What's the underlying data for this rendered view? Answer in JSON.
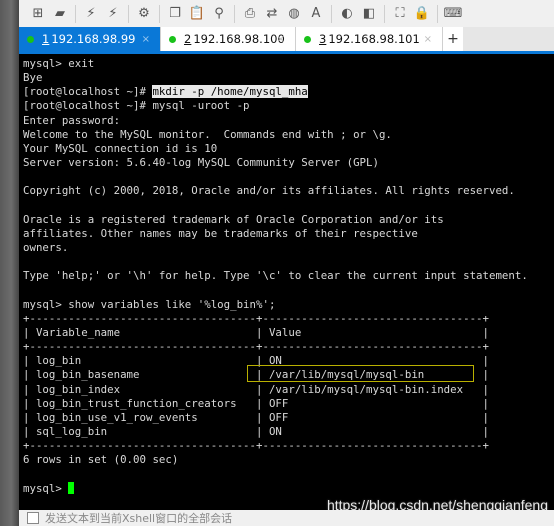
{
  "toolbar": {
    "icons": [
      "new-session-icon",
      "open-folder-icon",
      "connect-icon",
      "disconnect-icon",
      "properties-icon",
      "copy-icon",
      "paste-icon",
      "find-icon",
      "print-icon",
      "transfer-icon",
      "globe-icon",
      "font-icon",
      "xftp-icon",
      "script-icon",
      "fullscreen-icon",
      "lock-icon",
      "keyboard-icon"
    ]
  },
  "tabs": [
    {
      "number": "1",
      "label": " 192.168.98.99",
      "active": true,
      "close": "×"
    },
    {
      "number": "2",
      "label": " 192.168.98.100",
      "active": false,
      "close": "×"
    },
    {
      "number": "3",
      "label": " 192.168.98.101",
      "active": false,
      "close": "×"
    }
  ],
  "add_tab": "+",
  "terminal": {
    "lines": [
      "mysql> exit",
      "Bye",
      {
        "prefix": "[root@localhost ~]# ",
        "highlight": "mkdir -p /home/mysql_mha"
      },
      "[root@localhost ~]# mysql -uroot -p",
      "Enter password:",
      "Welcome to the MySQL monitor.  Commands end with ; or \\g.",
      "Your MySQL connection id is 10",
      "Server version: 5.6.40-log MySQL Community Server (GPL)",
      "",
      "Copyright (c) 2000, 2018, Oracle and/or its affiliates. All rights reserved.",
      "",
      "Oracle is a registered trademark of Oracle Corporation and/or its",
      "affiliates. Other names may be trademarks of their respective",
      "owners.",
      "",
      "Type 'help;' or '\\h' for help. Type '\\c' to clear the current input statement.",
      "",
      "mysql> show variables like '%log_bin%';",
      "+-----------------------------------+----------------------------------+",
      "| Variable_name                     | Value                            |",
      "+-----------------------------------+----------------------------------+",
      "| log_bin                           | ON                               |",
      "| log_bin_basename                  | /var/lib/mysql/mysql-bin         |",
      "| log_bin_index                     | /var/lib/mysql/mysql-bin.index   |",
      "| log_bin_trust_function_creators   | OFF                              |",
      "| log_bin_use_v1_row_events         | OFF                              |",
      "| sql_log_bin                       | ON                               |",
      "+-----------------------------------+----------------------------------+",
      "6 rows in set (0.00 sec)",
      "",
      {
        "prefix": "mysql> ",
        "cursor": true
      }
    ]
  },
  "watermark": "https://blog.csdn.net/shengqianfeng",
  "bottom_bar": {
    "label": "发送文本到当前Xshell窗口的全部会话"
  },
  "colors": {
    "tab_active": "#0a78d7",
    "status_dot": "#19c21a",
    "cursor": "#00ff00",
    "highlight_box": "#b9b000"
  }
}
